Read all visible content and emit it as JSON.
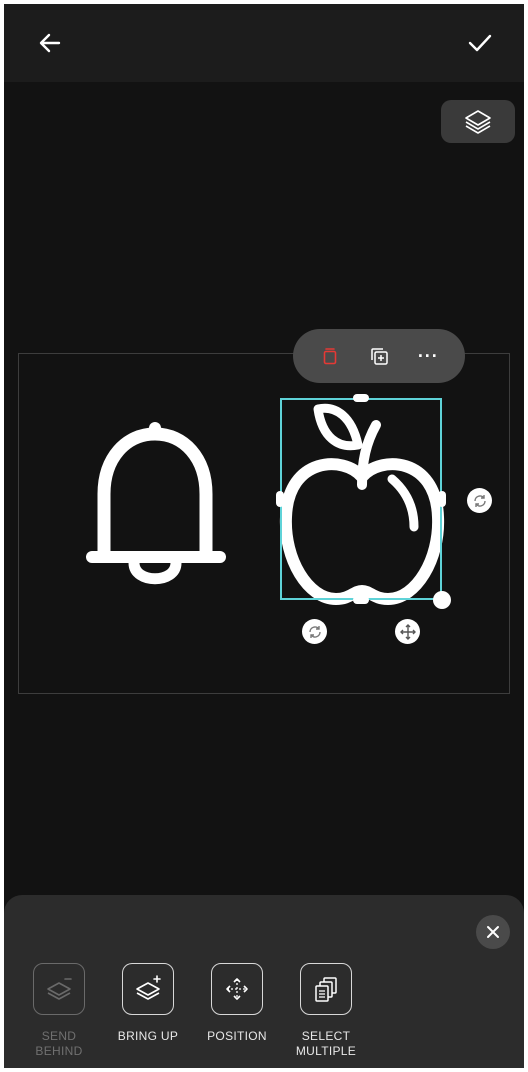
{
  "header": {
    "back_icon": "arrow-left-icon",
    "confirm_icon": "checkmark-icon"
  },
  "layers_button": {
    "icon": "layers-icon"
  },
  "object_toolbar": {
    "delete_icon": "trash-icon",
    "duplicate_icon": "duplicate-icon",
    "more_label": "···",
    "delete_color": "#e53935"
  },
  "canvas": {
    "elements": [
      {
        "name": "bell",
        "icon": "bell-icon"
      },
      {
        "name": "apple",
        "icon": "apple-icon",
        "selected": true
      }
    ],
    "selection_color": "#5fd3d8"
  },
  "bottom_sheet": {
    "close_icon": "close-icon",
    "tools": [
      {
        "label_line1": "SEND",
        "label_line2": "BEHIND",
        "enabled": false,
        "icon": "send-behind-icon"
      },
      {
        "label_line1": "BRING UP",
        "label_line2": "",
        "enabled": true,
        "icon": "bring-up-icon"
      },
      {
        "label_line1": "POSITION",
        "label_line2": "",
        "enabled": true,
        "icon": "position-icon"
      },
      {
        "label_line1": "SELECT",
        "label_line2": "MULTIPLE",
        "enabled": true,
        "icon": "select-multiple-icon"
      }
    ]
  }
}
